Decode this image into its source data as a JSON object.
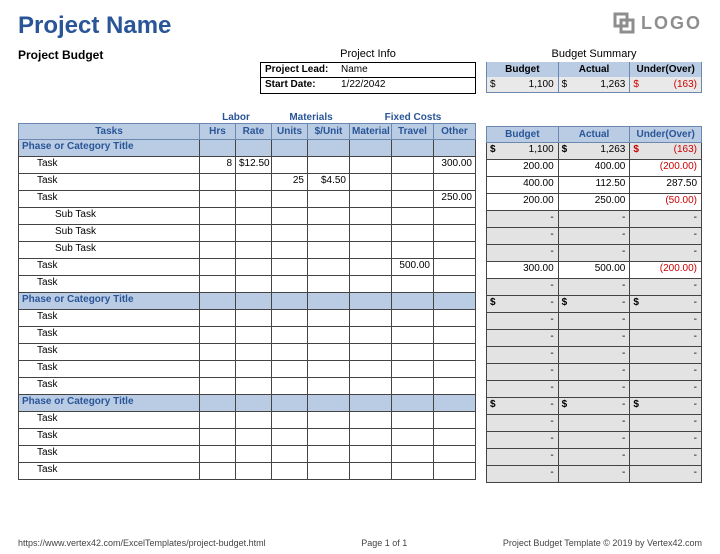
{
  "title": "Project Name",
  "subtitle": "Project Budget",
  "logo_text": "LOGO",
  "project_info": {
    "heading": "Project Info",
    "lead_label": "Project Lead:",
    "lead_value": "Name",
    "start_label": "Start Date:",
    "start_value": "1/22/2042"
  },
  "budget_summary": {
    "heading": "Budget Summary",
    "cols": [
      "Budget",
      "Actual",
      "Under(Over)"
    ],
    "budget": "1,100",
    "actual": "1,263",
    "under_over": "(163)",
    "currency": "$"
  },
  "group_headers": {
    "labor": "Labor",
    "materials": "Materials",
    "fixed": "Fixed Costs"
  },
  "columns": {
    "tasks": "Tasks",
    "hrs": "Hrs",
    "rate": "Rate",
    "units": "Units",
    "unit_cost": "$/Unit",
    "material": "Material",
    "travel": "Travel",
    "other": "Other",
    "budget": "Budget",
    "actual": "Actual",
    "under_over": "Under(Over)"
  },
  "phases": [
    {
      "title": "Phase or Category Title",
      "totals": {
        "budget": "1,100",
        "actual": "1,263",
        "under_over": "(163)",
        "negative": true
      },
      "rows": [
        {
          "label": "Task",
          "indent": 1,
          "hrs": "8",
          "rate": "$12.50",
          "units": "",
          "unit_cost": "",
          "material": "",
          "travel": "",
          "other": "300.00",
          "budget": "200.00",
          "actual": "400.00",
          "under_over": "(200.00)",
          "neg": true
        },
        {
          "label": "Task",
          "indent": 1,
          "hrs": "",
          "rate": "",
          "units": "25",
          "unit_cost": "$4.50",
          "material": "",
          "travel": "",
          "other": "",
          "budget": "400.00",
          "actual": "112.50",
          "under_over": "287.50",
          "neg": false
        },
        {
          "label": "Task",
          "indent": 1,
          "hrs": "",
          "rate": "",
          "units": "",
          "unit_cost": "",
          "material": "",
          "travel": "",
          "other": "250.00",
          "budget": "200.00",
          "actual": "250.00",
          "under_over": "(50.00)",
          "neg": true
        },
        {
          "label": "Sub Task",
          "indent": 2,
          "sub": true
        },
        {
          "label": "Sub Task",
          "indent": 2,
          "sub": true
        },
        {
          "label": "Sub Task",
          "indent": 2,
          "sub": true
        },
        {
          "label": "Task",
          "indent": 1,
          "hrs": "",
          "rate": "",
          "units": "",
          "unit_cost": "",
          "material": "",
          "travel": "500.00",
          "other": "",
          "budget": "300.00",
          "actual": "500.00",
          "under_over": "(200.00)",
          "neg": true
        },
        {
          "label": "Task",
          "indent": 1,
          "sub": true
        }
      ]
    },
    {
      "title": "Phase or Category Title",
      "totals": {
        "budget": "-",
        "actual": "-",
        "under_over": "-",
        "negative": false,
        "empty": true
      },
      "rows": [
        {
          "label": "Task",
          "indent": 1,
          "sub": true
        },
        {
          "label": "Task",
          "indent": 1,
          "sub": true
        },
        {
          "label": "Task",
          "indent": 1,
          "sub": true
        },
        {
          "label": "Task",
          "indent": 1,
          "sub": true
        },
        {
          "label": "Task",
          "indent": 1,
          "sub": true
        }
      ]
    },
    {
      "title": "Phase or Category Title",
      "totals": {
        "budget": "-",
        "actual": "-",
        "under_over": "-",
        "negative": false,
        "empty": true
      },
      "rows": [
        {
          "label": "Task",
          "indent": 1,
          "sub": true
        },
        {
          "label": "Task",
          "indent": 1,
          "sub": true
        },
        {
          "label": "Task",
          "indent": 1,
          "sub": true
        },
        {
          "label": "Task",
          "indent": 1,
          "sub": true
        }
      ]
    }
  ],
  "footer": {
    "left": "https://www.vertex42.com/ExcelTemplates/project-budget.html",
    "center": "Page 1 of 1",
    "right": "Project Budget Template © 2019 by Vertex42.com"
  },
  "dash": "-"
}
